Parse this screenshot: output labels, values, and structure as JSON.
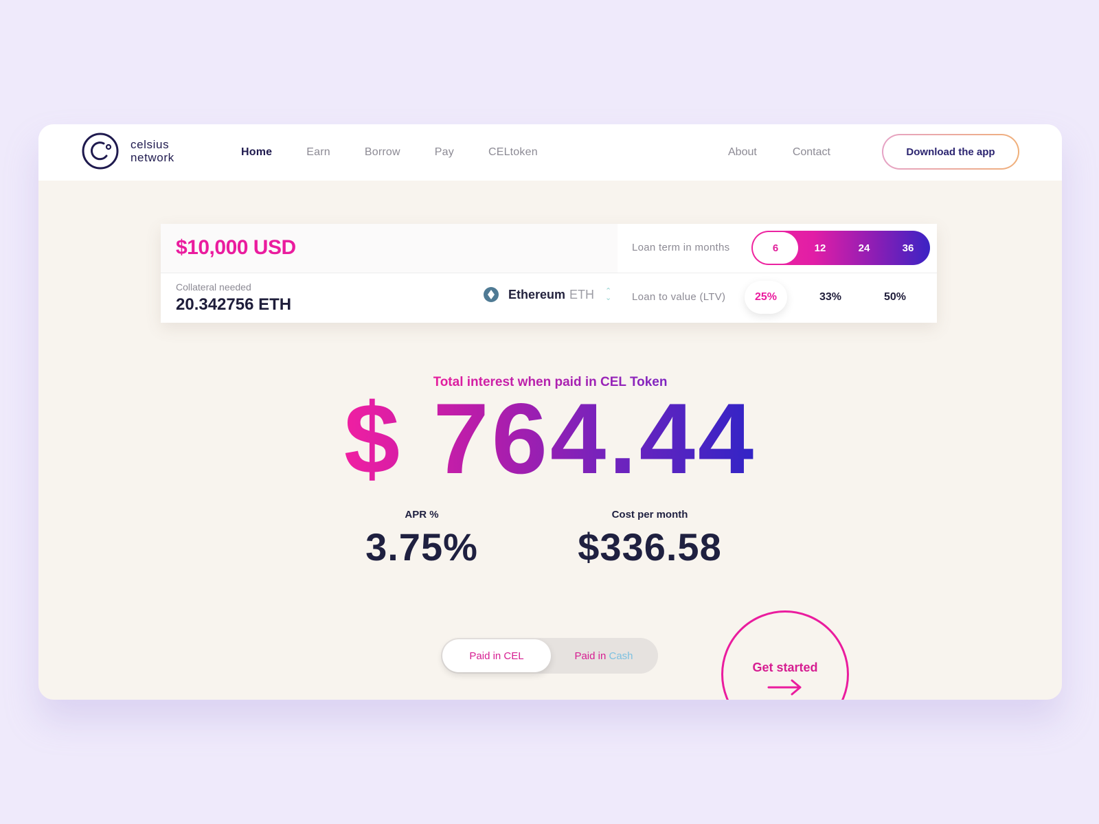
{
  "header": {
    "logo": {
      "line1": "celsius",
      "line2": "network"
    },
    "nav": [
      {
        "label": "Home",
        "active": true
      },
      {
        "label": "Earn",
        "active": false
      },
      {
        "label": "Borrow",
        "active": false
      },
      {
        "label": "Pay",
        "active": false
      },
      {
        "label": "CELtoken",
        "active": false
      }
    ],
    "nav_right": [
      {
        "label": "About"
      },
      {
        "label": "Contact"
      }
    ],
    "download_label": "Download the app"
  },
  "calculator": {
    "amount": "$10,000 USD",
    "loan_term_label": "Loan term in months",
    "loan_terms": [
      "6",
      "12",
      "24",
      "36"
    ],
    "selected_term": "6",
    "collateral_label": "Collateral needed",
    "collateral_value": "20.342756 ETH",
    "asset_name": "Ethereum",
    "asset_symbol": "ETH",
    "asset_icon": "ethereum-icon",
    "ltv_label": "Loan to value (LTV)",
    "ltv_options": [
      "25%",
      "33%",
      "50%"
    ],
    "selected_ltv": "25%"
  },
  "result": {
    "label": "Total interest when paid in CEL Token",
    "total_interest": "$ 764.44",
    "apr_label": "APR %",
    "apr_value": "3.75%",
    "cost_label": "Cost per month",
    "cost_value": "$336.58"
  },
  "payment": {
    "options": [
      "Paid in CEL",
      "Paid in"
    ],
    "cash_word": "Cash",
    "selected": "Paid in CEL"
  },
  "cta": {
    "label": "Get started"
  },
  "colors": {
    "brand_pink": "#ea1c9e",
    "brand_indigo": "#3124c6",
    "navy_text": "#1f1a4e",
    "page_bg": "#efeafb",
    "card_bg": "#f8f4ee"
  }
}
